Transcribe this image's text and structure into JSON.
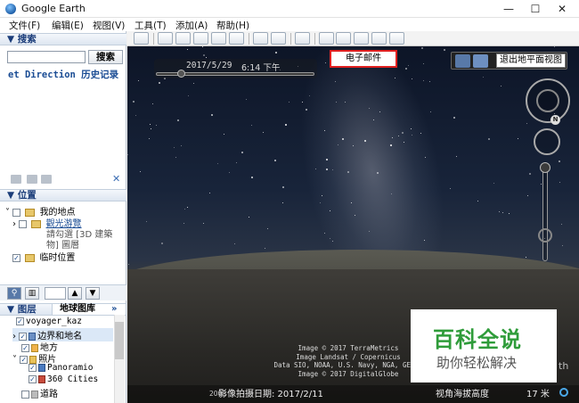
{
  "window": {
    "title": "Google Earth",
    "buttons": [
      "—",
      "☐",
      "✕"
    ]
  },
  "menu": [
    {
      "label": "文件(F)"
    },
    {
      "label": "编辑(E)"
    },
    {
      "label": "视图(V)"
    },
    {
      "label": "工具(T)"
    },
    {
      "label": "添加(A)"
    },
    {
      "label": "帮助(H)"
    }
  ],
  "search": {
    "header": "▼ 搜索",
    "button": "搜索",
    "value": "",
    "tabs_text": "et Direction 历史记录",
    "close": "✕"
  },
  "places": {
    "header": "▼ 位置",
    "my_places": "我的地点",
    "sightseeing": "觀光游覽",
    "sightseeing_note_1": "請勾選 [3D 建築",
    "sightseeing_note_2": "物] 圖層",
    "temp_places": "临时位置"
  },
  "layers": {
    "header": "▼ 图层",
    "gallery_tab": "地球图库",
    "gallery_arrow": "»",
    "items": [
      {
        "label": "voyager_kaz"
      },
      {
        "label": "边界和地名"
      },
      {
        "label": "地方"
      },
      {
        "label": "照片"
      },
      {
        "label": "Panoramio"
      },
      {
        "label": "360 Cities"
      },
      {
        "label": "道路"
      }
    ]
  },
  "map": {
    "date": "2017/5/29",
    "clock": "6:14 下午",
    "email_popup": "电子邮件",
    "exit_ground": "退出地平面视图",
    "compass_north": "N",
    "attribution": [
      "Image © 2017 TerraMetrics",
      "Image Landsat / Copernicus",
      "Data SIO, NOAA, U.S. Navy, NGA, GEBCO",
      "Image © 2017 DigitalGlobe"
    ],
    "status_imagery": "影像拍摄日期: 2017/2/11",
    "status_year": "2003",
    "status_eye_label": "视角海拔高度",
    "status_altitude": "17 米"
  },
  "watermark": {
    "line1": "百科全说",
    "line2": "助你轻松解决",
    "tail": "th"
  }
}
